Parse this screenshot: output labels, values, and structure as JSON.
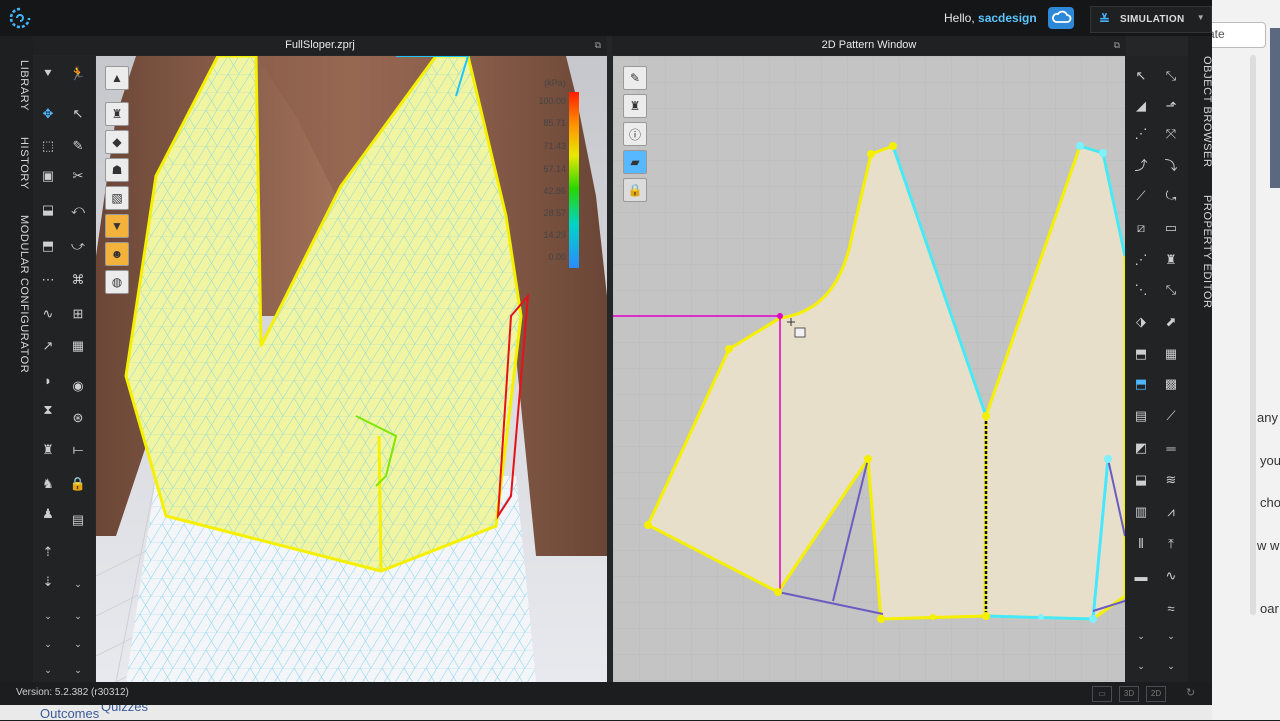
{
  "header": {
    "greeting_prefix": "Hello, ",
    "username": "sacdesign",
    "simulation_label": "SIMULATION"
  },
  "left_tabs": [
    "LIBRARY",
    "HISTORY",
    "MODULAR CONFIGURATOR"
  ],
  "right_tabs": [
    "OBJECT BROWSER",
    "PROPERTY EDITOR"
  ],
  "panel3d": {
    "title": "FullSloper.zprj"
  },
  "panel2d": {
    "title": "2D Pattern Window"
  },
  "legend": {
    "unit": "(kPa)",
    "values": [
      "100.00",
      "85.71",
      "71.43",
      "57.14",
      "42.86",
      "28.57",
      "14.29",
      "0.00"
    ]
  },
  "status": {
    "version": "Version: 5.2.382 (r30312)",
    "view_buttons": [
      "3D",
      "2D"
    ]
  },
  "background": {
    "bottom_link1": "Outcomes",
    "bottom_link2": "Quizzes",
    "right_fragments": [
      "ate",
      "any",
      "you",
      "cho",
      "w w",
      "oar"
    ]
  },
  "colors": {
    "accent": "#3fb4ff",
    "pattern_fill": "#e8dfcb",
    "pattern_outline": "#f4f000",
    "seam": "#46e8ff",
    "guide": "#e000c8",
    "garment": "#f1f5a2"
  }
}
